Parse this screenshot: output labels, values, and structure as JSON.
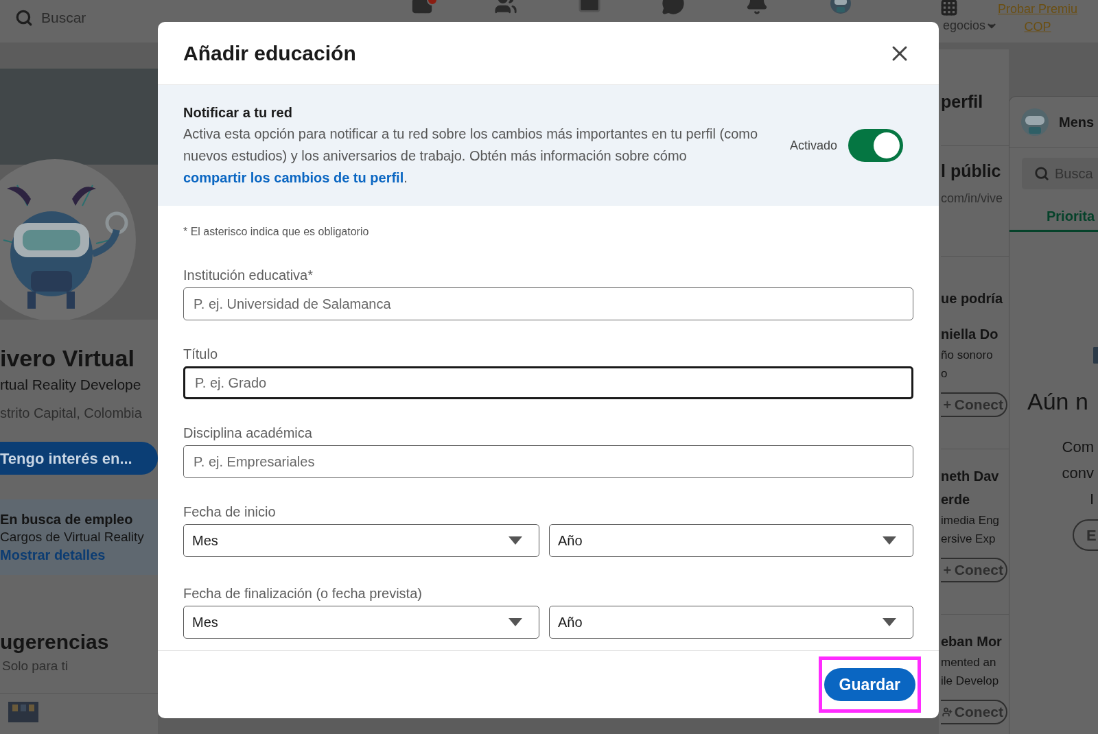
{
  "top_nav": {
    "search_placeholder": "Buscar",
    "icons": [
      {
        "kind": "home",
        "badge": true
      },
      {
        "kind": "people",
        "badge": false
      },
      {
        "kind": "briefcase",
        "badge": false
      },
      {
        "kind": "chat",
        "badge": false
      },
      {
        "kind": "bell",
        "badge": false
      },
      {
        "kind": "avatar",
        "badge": false
      }
    ],
    "business_label": "egocios",
    "premium_lines": [
      "Probar Premiu",
      "COP"
    ]
  },
  "profile": {
    "name": "ivero Virtual",
    "headline": "rtual Reality Develope",
    "location": "strito Capital, Colombia",
    "interest_button": "Tengo interés en...",
    "job_card": {
      "title": "En busca de empleo",
      "text": "Cargos de Virtual Reality",
      "link": "Mostrar detalles"
    },
    "suggestions": {
      "title": "ugerencias",
      "subtitle": "Solo para ti"
    }
  },
  "right_rail": {
    "profile_title": "perfil",
    "public_title": "l públic",
    "public_url": "com/in/vive",
    "people_title": "ue podría",
    "people": [
      {
        "name_lines": [
          "niella Do"
        ],
        "desc_lines": [
          "ño sonoro",
          "o"
        ],
        "button": "Conect",
        "kind": "plus"
      },
      {
        "name_lines": [
          "neth Dav",
          "erde"
        ],
        "desc_lines": [
          "imedia Eng",
          "ersive Exp"
        ],
        "button": "Conect",
        "kind": "plus"
      },
      {
        "name_lines": [
          "eban Mor"
        ],
        "desc_lines": [
          "mented an",
          "ile Develop"
        ],
        "button": "Conect",
        "kind": "person"
      }
    ]
  },
  "messaging": {
    "title": "Mens",
    "search_placeholder": "Busca",
    "tab": {
      "label": "Priorita",
      "selected": true
    },
    "empty_title": "Aún n",
    "empty_lines": [
      "Com",
      "conv",
      "I"
    ],
    "button": "E"
  },
  "modal": {
    "title": "Añadir educación",
    "notify": {
      "title": "Notificar a tu red",
      "text_before": "Activa esta opción para notificar a tu red sobre los cambios más importantes en tu perfil (como nuevos estudios) y los aniversarios de trabajo. Obtén más información sobre cómo ",
      "link": "compartir los cambios de tu perfil",
      "text_after": ".",
      "toggle": {
        "label": "Activado",
        "on": true
      }
    },
    "required_note": "* El asterisco indica que es obligatorio",
    "fields": [
      {
        "kind": "text",
        "label": "Institución educativa*",
        "placeholder": "P. ej. Universidad de Salamanca",
        "focused": false
      },
      {
        "kind": "text",
        "label": "Título",
        "placeholder": "P. ej. Grado",
        "focused": true
      },
      {
        "kind": "text",
        "label": "Disciplina académica",
        "placeholder": "P. ej. Empresariales",
        "focused": false
      },
      {
        "kind": "date",
        "label": "Fecha de inicio",
        "selects": [
          "Mes",
          "Año"
        ]
      },
      {
        "kind": "date",
        "label": "Fecha de finalización (o fecha prevista)",
        "selects": [
          "Mes",
          "Año"
        ]
      }
    ],
    "save_button": {
      "label": "Guardar",
      "highlighted": true
    }
  }
}
